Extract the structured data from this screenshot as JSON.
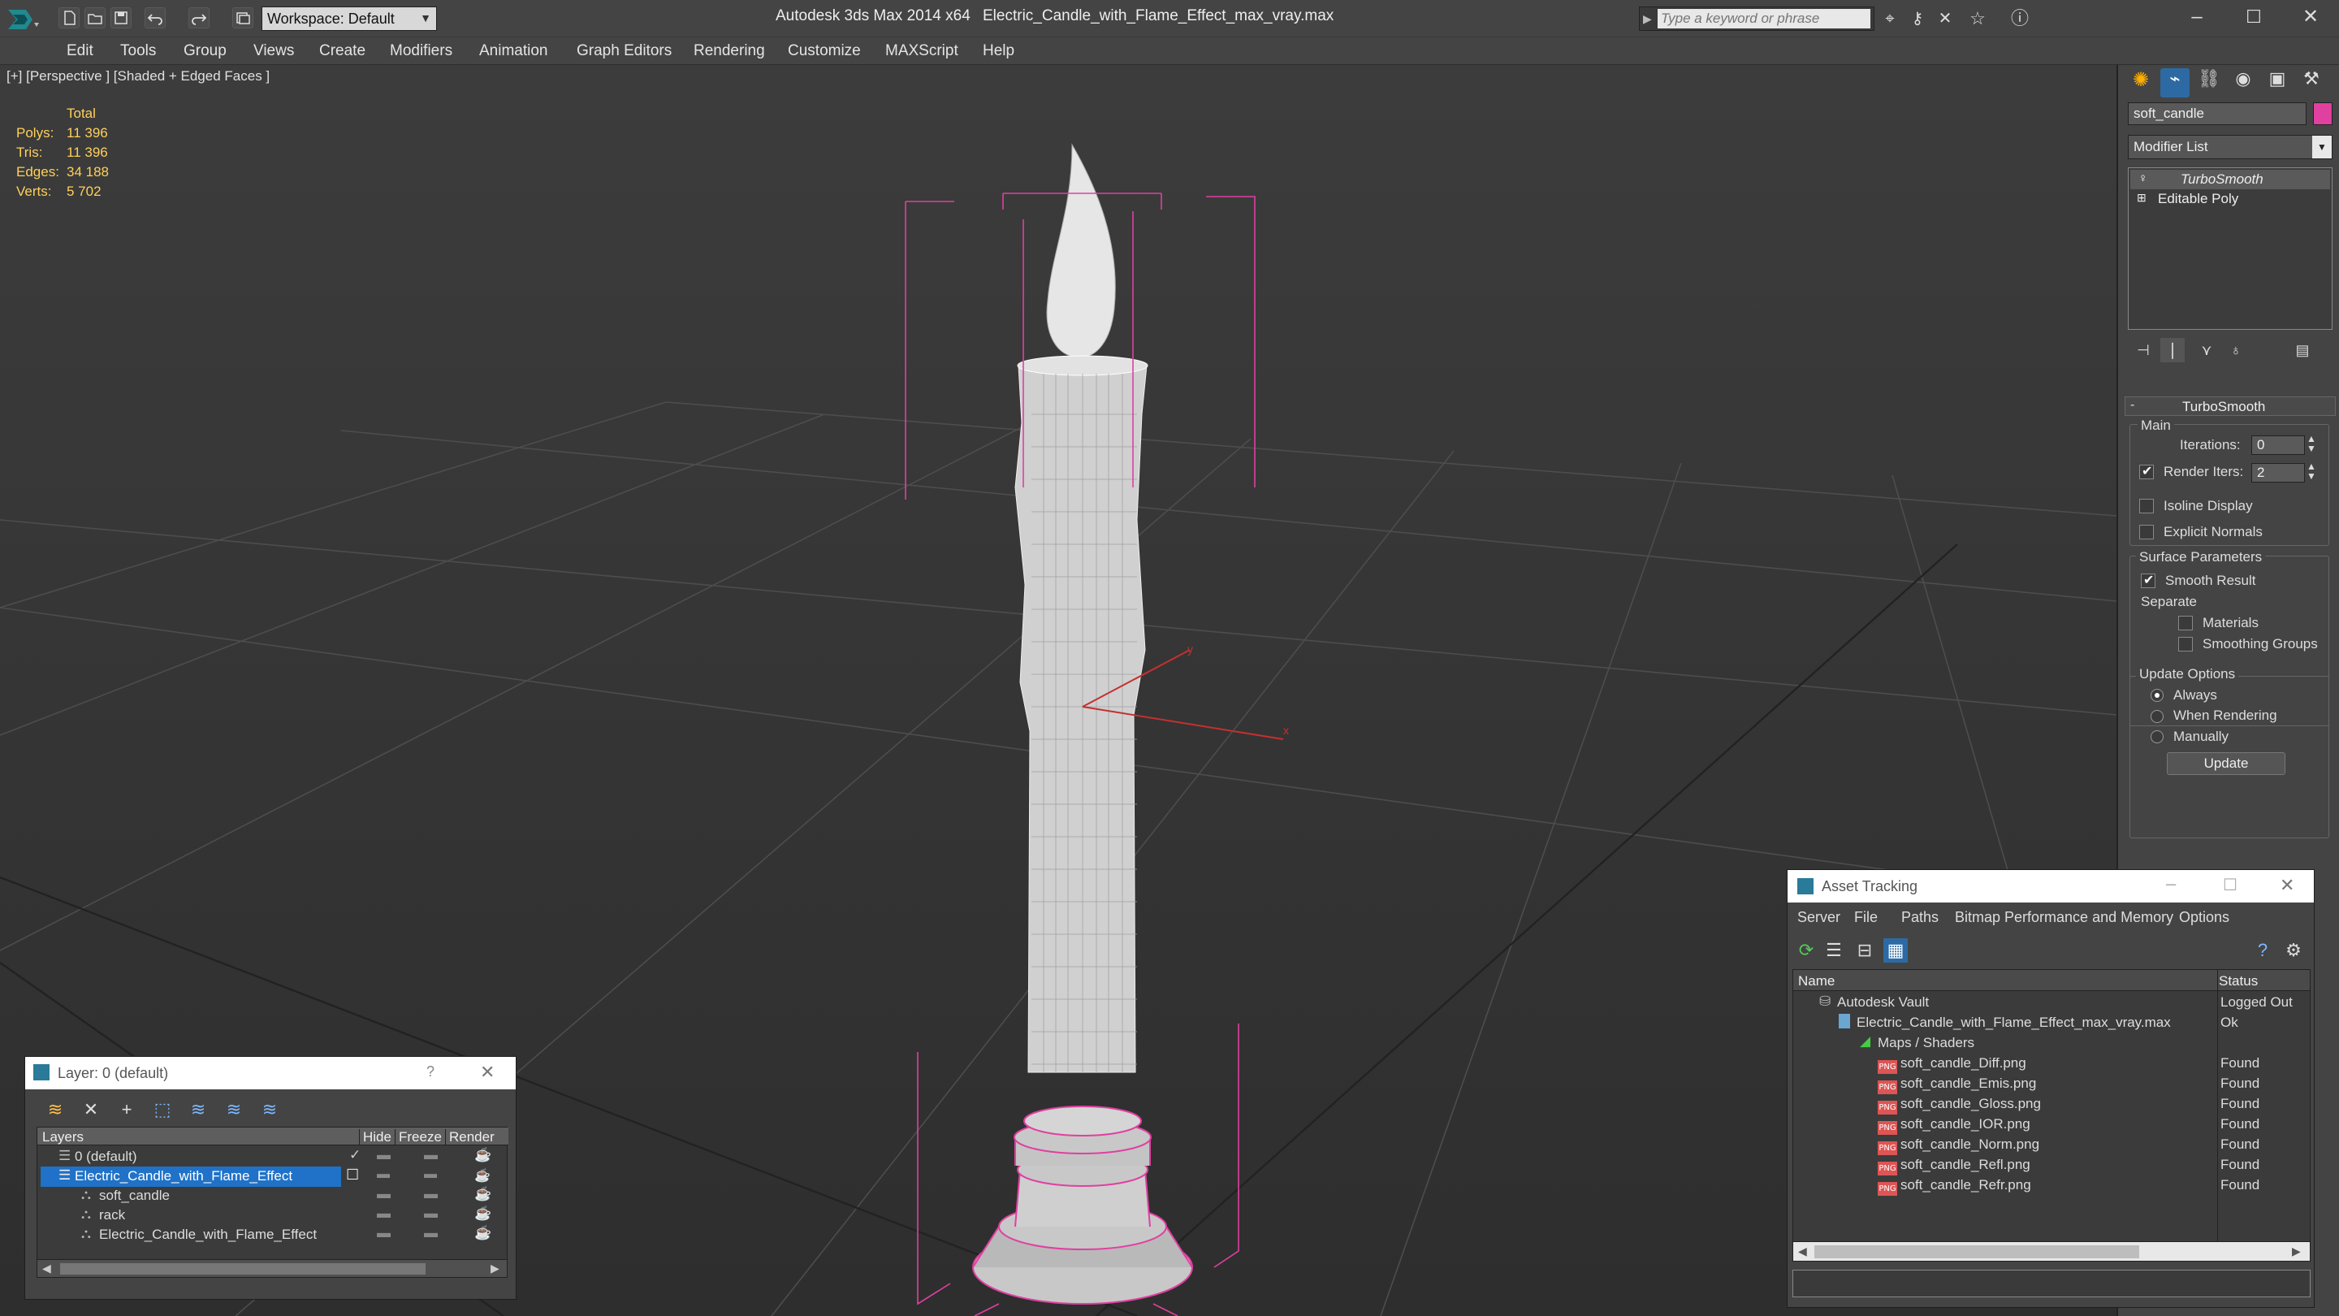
{
  "window": {
    "app_title": "Autodesk 3ds Max 2014 x64",
    "file_title": "Electric_Candle_with_Flame_Effect_max_vray.max",
    "workspace": "Workspace: Default",
    "search_placeholder": "Type a keyword or phrase"
  },
  "menu": [
    "Edit",
    "Tools",
    "Group",
    "Views",
    "Create",
    "Modifiers",
    "Animation",
    "Graph Editors",
    "Rendering",
    "Customize",
    "MAXScript",
    "Help"
  ],
  "viewport": {
    "label": "[+] [Perspective ] [Shaded + Edged Faces ]",
    "stats_header": "Total",
    "stats": [
      {
        "label": "Polys:",
        "value": "11 396"
      },
      {
        "label": "Tris:",
        "value": "11 396"
      },
      {
        "label": "Edges:",
        "value": "34 188"
      },
      {
        "label": "Verts:",
        "value": "5 702"
      }
    ],
    "axis_x": "x",
    "axis_y": "y"
  },
  "command_panel": {
    "object_name": "soft_candle",
    "object_color": "#e040a0",
    "modifier_list": "Modifier List",
    "stack": [
      "TurboSmooth",
      "Editable Poly"
    ],
    "rollout_title": "TurboSmooth",
    "main_label": "Main",
    "iterations_label": "Iterations:",
    "iterations_value": "0",
    "render_iters_label": "Render Iters:",
    "render_iters_value": "2",
    "render_iters_checked": true,
    "isoline_label": "Isoline Display",
    "explicit_normals_label": "Explicit Normals",
    "surface_params_label": "Surface Parameters",
    "smooth_result_label": "Smooth Result",
    "separate_label": "Separate",
    "materials_label": "Materials",
    "smoothing_groups_label": "Smoothing Groups",
    "update_options_label": "Update Options",
    "always_label": "Always",
    "when_rendering_label": "When Rendering",
    "manually_label": "Manually",
    "update_button": "Update"
  },
  "layer_panel": {
    "title": "Layer: 0 (default)",
    "help": "?",
    "columns": [
      "Layers",
      "Hide",
      "Freeze",
      "Render"
    ],
    "rows": [
      {
        "name": "0 (default)",
        "indent": 1,
        "selected": false
      },
      {
        "name": "Electric_Candle_with_Flame_Effect",
        "indent": 1,
        "selected": true
      },
      {
        "name": "soft_candle",
        "indent": 2,
        "selected": false
      },
      {
        "name": "rack",
        "indent": 2,
        "selected": false
      },
      {
        "name": "Electric_Candle_with_Flame_Effect",
        "indent": 2,
        "selected": false
      }
    ]
  },
  "asset_panel": {
    "title": "Asset Tracking",
    "menu": [
      "Server",
      "File",
      "Paths",
      "Bitmap Performance and Memory",
      "Options"
    ],
    "columns": [
      "Name",
      "Status"
    ],
    "rows": [
      {
        "name": "Autodesk Vault",
        "status": "Logged Out",
        "indent": 1,
        "icon": "vault"
      },
      {
        "name": "Electric_Candle_with_Flame_Effect_max_vray.max",
        "status": "Ok",
        "indent": 2,
        "icon": "max"
      },
      {
        "name": "Maps / Shaders",
        "status": "",
        "indent": 3,
        "icon": "maps"
      },
      {
        "name": "soft_candle_Diff.png",
        "status": "Found",
        "indent": 4,
        "icon": "png"
      },
      {
        "name": "soft_candle_Emis.png",
        "status": "Found",
        "indent": 4,
        "icon": "png"
      },
      {
        "name": "soft_candle_Gloss.png",
        "status": "Found",
        "indent": 4,
        "icon": "png"
      },
      {
        "name": "soft_candle_IOR.png",
        "status": "Found",
        "indent": 4,
        "icon": "png"
      },
      {
        "name": "soft_candle_Norm.png",
        "status": "Found",
        "indent": 4,
        "icon": "png"
      },
      {
        "name": "soft_candle_Refl.png",
        "status": "Found",
        "indent": 4,
        "icon": "png"
      },
      {
        "name": "soft_candle_Refr.png",
        "status": "Found",
        "indent": 4,
        "icon": "png"
      }
    ],
    "png_badge": "PNG"
  }
}
